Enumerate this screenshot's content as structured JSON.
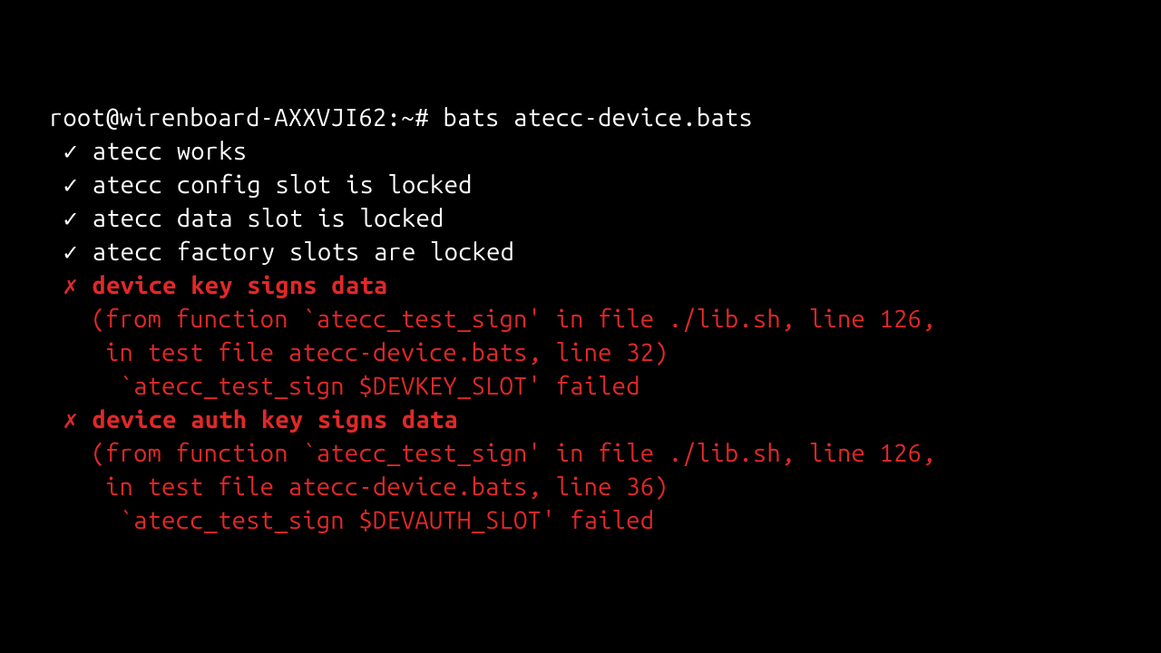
{
  "terminal": {
    "prompt": "root@wirenboard-AXXVJI62:~# bats atecc-device.bats",
    "pass_mark": " ✓ ",
    "fail_mark": " ✗ ",
    "tests": {
      "pass1": "atecc works",
      "pass2": "atecc config slot is locked",
      "pass3": "atecc data slot is locked",
      "pass4": "atecc factory slots are locked",
      "fail1_title": "device key signs data",
      "fail1_line1": "   (from function `atecc_test_sign' in file ./lib.sh, line 126,",
      "fail1_line2": "    in test file atecc-device.bats, line 32)",
      "fail1_line3": "     `atecc_test_sign $DEVKEY_SLOT' failed",
      "fail2_title": "device auth key signs data",
      "fail2_line1": "   (from function `atecc_test_sign' in file ./lib.sh, line 126,",
      "fail2_line2": "    in test file atecc-device.bats, line 36)",
      "fail2_line3": "     `atecc_test_sign $DEVAUTH_SLOT' failed"
    }
  }
}
